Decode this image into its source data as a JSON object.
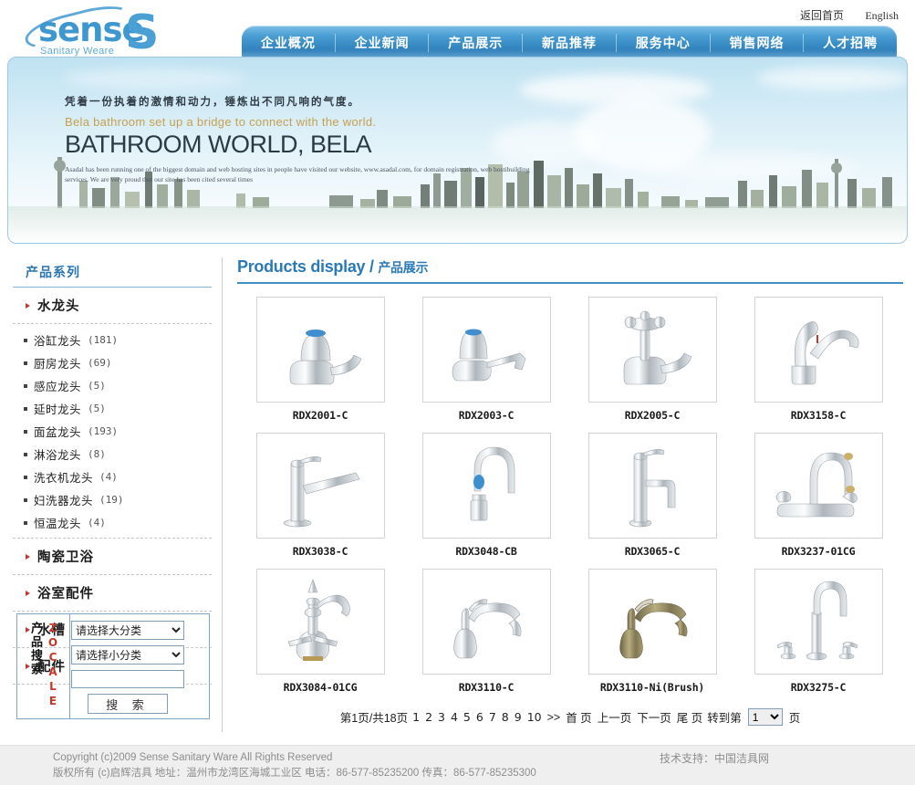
{
  "header": {
    "logo_word": "sense",
    "logo_sub": "Sanitary Weare",
    "top_links": [
      {
        "label": "返回首页",
        "name": "home-link"
      },
      {
        "label": "English",
        "name": "english-link"
      }
    ],
    "nav": [
      "企业概况",
      "企业新闻",
      "产品展示",
      "新品推荐",
      "服务中心",
      "销售网络",
      "人才招聘"
    ]
  },
  "banner": {
    "cn_line": "凭着一份执着的激情和动力，锤炼出不同凡响的气度。",
    "en_line": "Bela bathroom set up a bridge to connect with the world.",
    "headline": "BATHROOM WORLD, BELA",
    "small_text": "Asadal has been running one of the biggest domain and web hosting sites in people have visited our website, www.asadal.com, for domain registration, web hostibuilding services. We are very proud that our site has been cited several times"
  },
  "sidebar": {
    "title": "产品系列",
    "categories": [
      {
        "label": "水龙头",
        "expanded": true
      },
      {
        "label": "陶瓷卫浴",
        "expanded": false
      },
      {
        "label": "浴室配件",
        "expanded": false
      },
      {
        "label": "水槽",
        "expanded": false
      },
      {
        "label": "配件",
        "expanded": false
      }
    ],
    "subitems": [
      {
        "label": "浴缸龙头",
        "count": "(181)"
      },
      {
        "label": "厨房龙头",
        "count": "(69)"
      },
      {
        "label": "感应龙头",
        "count": "(5)"
      },
      {
        "label": "延时龙头",
        "count": "(5)"
      },
      {
        "label": "面盆龙头",
        "count": "(193)"
      },
      {
        "label": "淋浴龙头",
        "count": "(8)"
      },
      {
        "label": "洗衣机龙头",
        "count": "(4)"
      },
      {
        "label": "妇洗器龙头",
        "count": "(19)"
      },
      {
        "label": "恒温龙头",
        "count": "(4)"
      }
    ],
    "search": {
      "vertical_brand": "ZOCALE",
      "vertical_label": "产品搜索",
      "big_category": "请选择大分类",
      "small_category": "请选择小分类",
      "keyword_value": "",
      "keyword_placeholder": "",
      "button_label": "搜 索"
    }
  },
  "content": {
    "title_en": "Products display",
    "title_sep": "/",
    "title_cn": "产品展示",
    "products": [
      {
        "code": "RDX2001-C",
        "kind": "pillar-blue"
      },
      {
        "code": "RDX2003-C",
        "kind": "basin-blue"
      },
      {
        "code": "RDX2005-C",
        "kind": "cross-handle"
      },
      {
        "code": "RDX3158-C",
        "kind": "single-lever"
      },
      {
        "code": "RDX3038-C",
        "kind": "slim-lever"
      },
      {
        "code": "RDX3048-CB",
        "kind": "gooseneck-blue"
      },
      {
        "code": "RDX3065-C",
        "kind": "tall-pillar"
      },
      {
        "code": "RDX3237-01CG",
        "kind": "two-handle-deck"
      },
      {
        "code": "RDX3084-01CG",
        "kind": "ornate-bridge"
      },
      {
        "code": "RDX3110-C",
        "kind": "swan-lever"
      },
      {
        "code": "RDX3110-Ni(Brush)",
        "kind": "swan-bronze"
      },
      {
        "code": "RDX3275-C",
        "kind": "three-hole"
      }
    ],
    "pagination": {
      "summary": "第1页/共18页",
      "pages": [
        "1",
        "2",
        "3",
        "4",
        "5",
        "6",
        "7",
        "8",
        "9",
        "10"
      ],
      "next_group": ">>",
      "first": "首 页",
      "prev": "上一页",
      "next": "下一页",
      "last": "尾 页",
      "goto_label": "转到第",
      "goto_value": "1",
      "goto_suffix": "页"
    }
  },
  "footer": {
    "line1": "Copyright (c)2009  Sense  Sanitary Ware All Rights Reserved",
    "line2": "版权所有 (c)启辉洁具   地址：温州市龙湾区海城工业区   电话：86-577-85235200     传真：86-577-85235300",
    "support": "技术支持：中国洁具网"
  },
  "colors": {
    "brand_blue": "#2b7ab8",
    "nav_blue": "#3d90c8",
    "accent_red": "#c0392b",
    "footer_gray": "#8d8d8d"
  }
}
